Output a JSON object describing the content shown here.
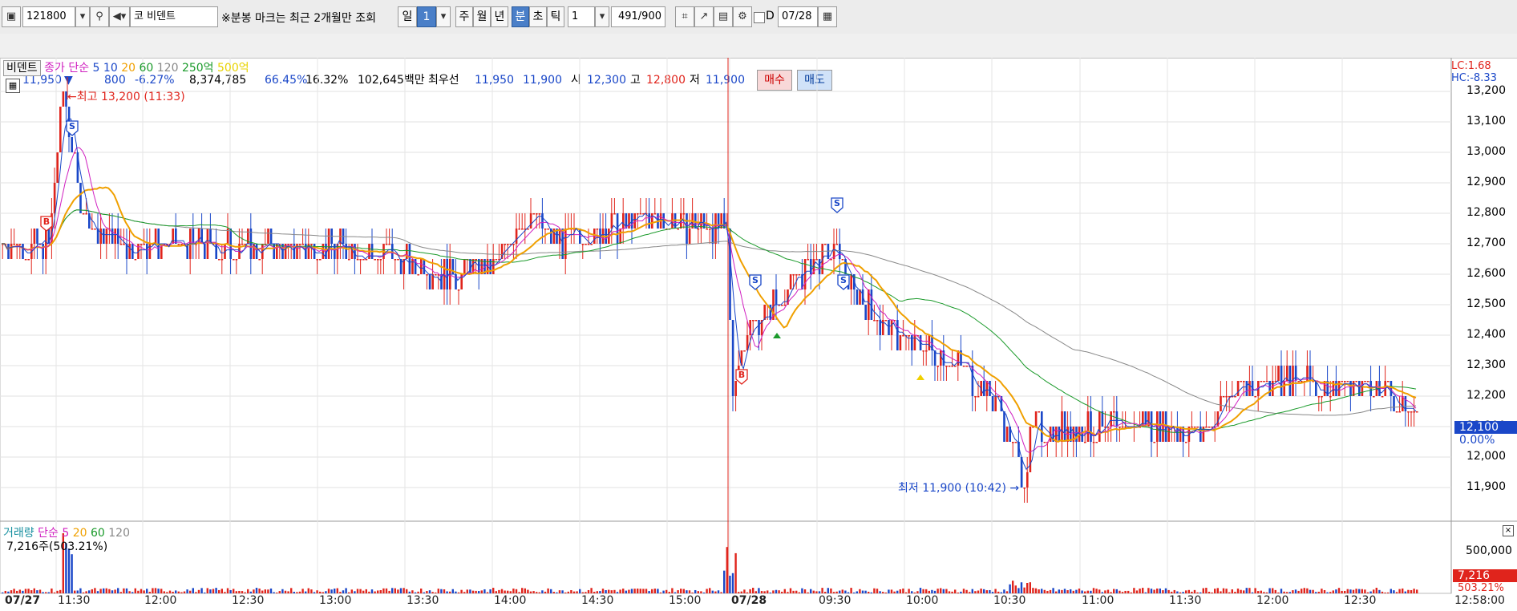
{
  "toolbar": {
    "code": "121800",
    "market_prefix": "코",
    "name": "비덴트",
    "notice": "※분봉 마크는 최근 2개월만 조회",
    "periods": [
      "일",
      "1",
      "주",
      "월",
      "년",
      "분",
      "초",
      "틱"
    ],
    "interval_value": "1",
    "count": "491",
    "count_max": "/900",
    "d_label": "D",
    "date": "07/28"
  },
  "quote": {
    "price": "11,950",
    "change": "800",
    "change_pct": "-6.27%",
    "volume": "8,374,785",
    "ratio1": "66.45%",
    "ratio2": "16.32%",
    "amount": "102,645백만",
    "best_label": "최우선",
    "best_ask": "11,950",
    "best_bid": "11,900",
    "open_label": "시",
    "open": "12,300",
    "high_label": "고",
    "high": "12,800",
    "low_label": "저",
    "low": "11,900",
    "buy_button": "매수",
    "sell_button": "매도"
  },
  "price_legend": {
    "name": "비덴트",
    "price_type": "종가",
    "ma_type": "단순",
    "ma": [
      "5",
      "10",
      "20",
      "60",
      "120"
    ],
    "amt1": "250억",
    "amt2": "500억"
  },
  "volume_legend": {
    "name": "거래량",
    "ma_type": "단순",
    "ma": [
      "5",
      "20",
      "60",
      "120"
    ],
    "current": "7,216주(503.21%)"
  },
  "annotations": {
    "high": "최고 13,200 (11:33)",
    "low": "최저 11,900 (10:42)",
    "lc": "LC:1.68",
    "hc": "HC:-8.33"
  },
  "price_axis": [
    "13,200",
    "13,100",
    "13,000",
    "12,900",
    "12,800",
    "12,700",
    "12,600",
    "12,500",
    "12,400",
    "12,300",
    "12,200",
    "12,100",
    "12,000",
    "11,900"
  ],
  "current_price": "12,100",
  "current_pct": "0.00%",
  "volume_axis": "500,000",
  "volume_current": "7,216",
  "volume_pct": "503.21%",
  "time_axis": [
    "07/27",
    "11:30",
    "12:00",
    "12:30",
    "13:00",
    "13:30",
    "14:00",
    "14:30",
    "15:00",
    "07/28",
    "09:30",
    "10:00",
    "10:30",
    "11:00",
    "11:30",
    "12:00",
    "12:30",
    "12:58:00"
  ],
  "signal_labels": {
    "buy": "B",
    "sell": "S"
  },
  "colors": {
    "up": "#e0241c",
    "down": "#1a47c8",
    "ma5": "#1a47c8",
    "ma10": "#d020c0",
    "ma20": "#f0a000",
    "ma60": "#1a9a2a",
    "ma120": "#888888"
  },
  "chart_data": {
    "type": "candlestick",
    "xlabel": "",
    "ylabel": "",
    "ylim": [
      11800,
      13250
    ],
    "key_points": [
      {
        "x": "07/27 11:30",
        "y": 12700
      },
      {
        "x": "07/27 11:33",
        "y": 13200
      },
      {
        "x": "07/27 12:00",
        "y": 12700
      },
      {
        "x": "07/27 13:30",
        "y": 12600
      },
      {
        "x": "07/27 14:00",
        "y": 12800
      },
      {
        "x": "07/27 15:00",
        "y": 12750
      },
      {
        "x": "07/28 09:00",
        "y": 12300
      },
      {
        "x": "07/28 09:30",
        "y": 12700
      },
      {
        "x": "07/28 10:00",
        "y": 12350
      },
      {
        "x": "07/28 10:42",
        "y": 11900
      },
      {
        "x": "07/28 11:00",
        "y": 12100
      },
      {
        "x": "07/28 12:00",
        "y": 12250
      },
      {
        "x": "07/28 12:58",
        "y": 12100
      }
    ]
  }
}
